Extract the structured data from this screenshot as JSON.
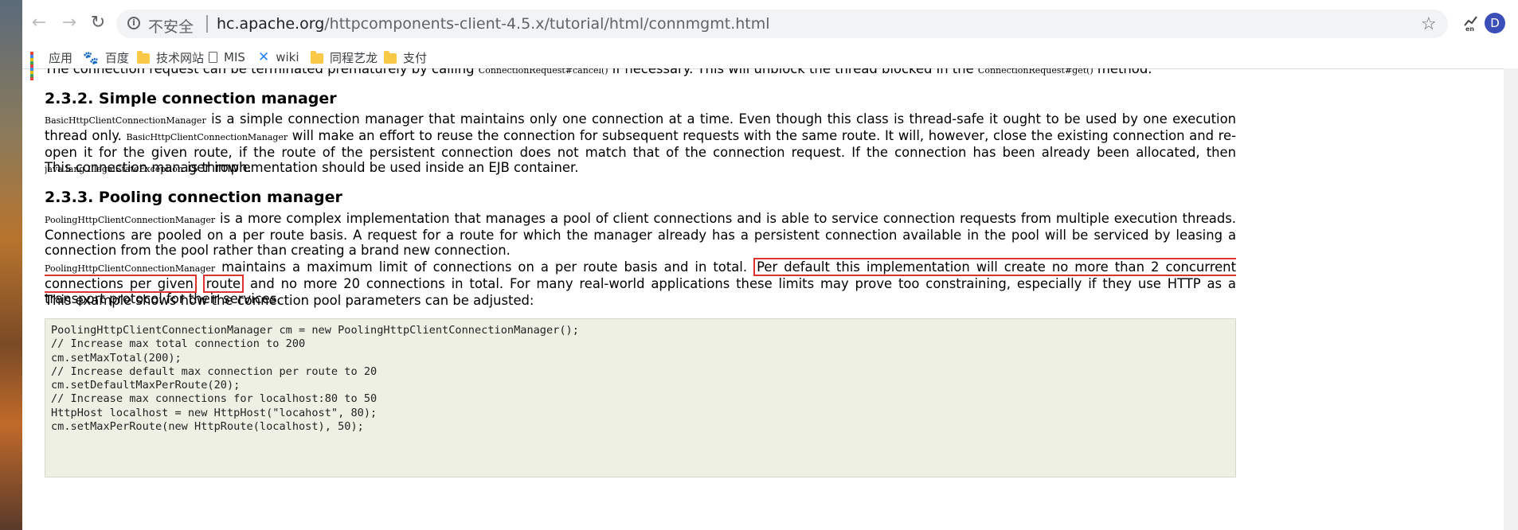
{
  "browser": {
    "back_label": "←",
    "forward_label": "→",
    "reload_label": "↻",
    "security_label": "不安全",
    "url_host": "hc.apache.org",
    "url_path": "/httpcomponents-client-4.5.x/tutorial/html/connmgmt.html",
    "star_label": "☆",
    "extension_label": "en",
    "avatar_label": "D"
  },
  "bookmarks": [
    {
      "label": "应用",
      "icon": "apps-icon"
    },
    {
      "label": "百度",
      "icon": "baidu-paw-icon"
    },
    {
      "label": "技术网站",
      "icon": "folder-icon"
    },
    {
      "label": "MIS",
      "icon": "page-icon"
    },
    {
      "label": "wiki",
      "icon": "confluence-icon"
    },
    {
      "label": "同程艺龙",
      "icon": "folder-icon"
    },
    {
      "label": "支付",
      "icon": "folder-icon"
    }
  ],
  "content": {
    "p_cancel": {
      "pre": "The connection request can be terminated prematurely by calling ",
      "code1": "ConnectionRequest#cancel()",
      "mid": " if necessary. This will unblock the thread blocked in the ",
      "code2": "ConnectionRequest#get()",
      "post": " method."
    },
    "h_simple": "2.3.2. Simple connection manager",
    "p_simple1": {
      "code1": "BasicHttpClientConnectionManager",
      "t1": " is a simple connection manager that maintains only one connection at a time. Even though this class is thread-safe it ought to be used by one execution thread only. ",
      "code2": "BasicHttpClientConnectionManager",
      "t2": " will make an effort to reuse the connection for subsequent requests with the same route. It will, however, close the existing connection and re-open it for the given route, if the route of the persistent connection does not match that of the connection request. If the connection has been already been allocated, then ",
      "code3": "java.lang.IllegalStateException",
      "t3": " is thrown."
    },
    "p_simple2": "This connection manager implementation should be used inside an EJB container.",
    "h_pooling": "2.3.3. Pooling connection manager",
    "p_pool1": {
      "code1": "PoolingHttpClientConnectionManager",
      "t1": " is a more complex implementation that manages a pool of client connections and is able to service connection requests from multiple execution threads. Connections are pooled on a per route basis. A request for a route for which the manager already has a persistent connection available in the pool will be serviced by leasing a connection from the pool rather than creating a brand new connection."
    },
    "p_pool2": {
      "code1": "PoolingHttpClientConnectionManager",
      "t1": " maintains a maximum limit of connections on a per route basis and in total. ",
      "highlight1": "Per default this implementation will create no more than 2 concurrent connections per given",
      "highlight2": "route",
      "t2": " and no more 20 connections in total. For many real-world applications these limits may prove too constraining, especially if they use HTTP as a transport protocol for their services."
    },
    "p_example": "This example shows how the connection pool parameters can be adjusted:",
    "code_lines": [
      "PoolingHttpClientConnectionManager cm = new PoolingHttpClientConnectionManager();",
      "// Increase max total connection to 200",
      "cm.setMaxTotal(200);",
      "// Increase default max connection per route to 20",
      "cm.setDefaultMaxPerRoute(20);",
      "// Increase max connections for localhost:80 to 50",
      "HttpHost localhost = new HttpHost(\"locahost\", 80);",
      "cm.setMaxPerRoute(new HttpRoute(localhost), 50);"
    ]
  },
  "colors": {
    "highlight_box": "#e0332e",
    "code_background": "#eff0e4"
  }
}
